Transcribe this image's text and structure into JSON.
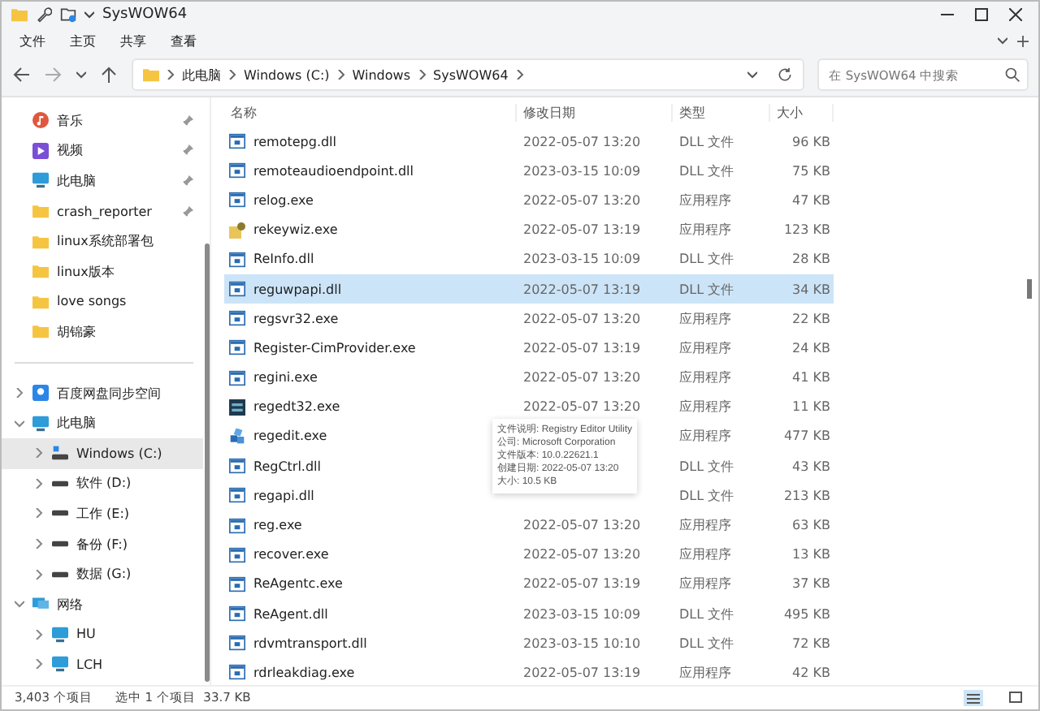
{
  "window": {
    "title": "SysWOW64"
  },
  "menu": [
    "文件",
    "主页",
    "共享",
    "查看"
  ],
  "breadcrumb": [
    "此电脑",
    "Windows (C:)",
    "Windows",
    "SysWOW64"
  ],
  "search": {
    "placeholder": "在 SysWOW64 中搜索"
  },
  "quick_access": [
    {
      "label": "音乐",
      "kind": "music",
      "pinned": true
    },
    {
      "label": "视频",
      "kind": "video",
      "pinned": true
    },
    {
      "label": "此电脑",
      "kind": "pc",
      "pinned": true
    },
    {
      "label": "crash_reporter",
      "kind": "folder",
      "pinned": true
    },
    {
      "label": "linux系统部署包",
      "kind": "folder",
      "pinned": false
    },
    {
      "label": "linux版本",
      "kind": "folder",
      "pinned": false
    },
    {
      "label": "love songs",
      "kind": "folder",
      "pinned": false
    },
    {
      "label": "胡锦豪",
      "kind": "folder",
      "pinned": false
    }
  ],
  "tree": [
    {
      "label": "百度网盘同步空间",
      "kind": "cloud",
      "expanded": false,
      "selected": false
    },
    {
      "label": "此电脑",
      "kind": "pc",
      "expanded": true,
      "selected": false,
      "children": [
        {
          "label": "Windows (C:)",
          "kind": "sysdrive",
          "expanded": false,
          "selected": true
        },
        {
          "label": "软件 (D:)",
          "kind": "drive",
          "expanded": false,
          "selected": false
        },
        {
          "label": "工作 (E:)",
          "kind": "drive",
          "expanded": false,
          "selected": false
        },
        {
          "label": "备份 (F:)",
          "kind": "drive",
          "expanded": false,
          "selected": false
        },
        {
          "label": "数据 (G:)",
          "kind": "drive",
          "expanded": false,
          "selected": false
        }
      ]
    },
    {
      "label": "网络",
      "kind": "network",
      "expanded": true,
      "selected": false,
      "children": [
        {
          "label": "HU",
          "kind": "pc",
          "expanded": false,
          "selected": false
        },
        {
          "label": "LCH",
          "kind": "pc",
          "expanded": false,
          "selected": false
        }
      ]
    }
  ],
  "table": {
    "columns": [
      "名称",
      "修改日期",
      "类型",
      "大小"
    ],
    "rows": [
      {
        "name": "remotepg.dll",
        "kind": "app",
        "date": "2022-05-07 13:20",
        "type": "DLL 文件",
        "size": "96 KB",
        "selected": false
      },
      {
        "name": "remoteaudioendpoint.dll",
        "kind": "app",
        "date": "2023-03-15 10:09",
        "type": "DLL 文件",
        "size": "75 KB",
        "selected": false
      },
      {
        "name": "relog.exe",
        "kind": "app",
        "date": "2022-05-07 13:20",
        "type": "应用程序",
        "size": "47 KB",
        "selected": false
      },
      {
        "name": "rekeywiz.exe",
        "kind": "key",
        "date": "2022-05-07 13:19",
        "type": "应用程序",
        "size": "123 KB",
        "selected": false
      },
      {
        "name": "ReInfo.dll",
        "kind": "app",
        "date": "2023-03-15 10:09",
        "type": "DLL 文件",
        "size": "28 KB",
        "selected": false
      },
      {
        "name": "reguwpapi.dll",
        "kind": "app",
        "date": "2022-05-07 13:19",
        "type": "DLL 文件",
        "size": "34 KB",
        "selected": true
      },
      {
        "name": "regsvr32.exe",
        "kind": "app",
        "date": "2022-05-07 13:20",
        "type": "应用程序",
        "size": "22 KB",
        "selected": false
      },
      {
        "name": "Register-CimProvider.exe",
        "kind": "app",
        "date": "2022-05-07 13:19",
        "type": "应用程序",
        "size": "24 KB",
        "selected": false
      },
      {
        "name": "regini.exe",
        "kind": "app",
        "date": "2022-05-07 13:20",
        "type": "应用程序",
        "size": "41 KB",
        "selected": false
      },
      {
        "name": "regedt32.exe",
        "kind": "dark",
        "date": "2022-05-07 13:20",
        "type": "应用程序",
        "size": "11 KB",
        "selected": false
      },
      {
        "name": "regedit.exe",
        "kind": "cubes",
        "type": "应用程序",
        "size": "477 KB",
        "selected": false
      },
      {
        "name": "RegCtrl.dll",
        "kind": "app",
        "type": "DLL 文件",
        "size": "43 KB",
        "selected": false
      },
      {
        "name": "regapi.dll",
        "kind": "app",
        "type": "DLL 文件",
        "size": "213 KB",
        "selected": false
      },
      {
        "name": "reg.exe",
        "kind": "app",
        "date": "2022-05-07 13:20",
        "type": "应用程序",
        "size": "63 KB",
        "selected": false
      },
      {
        "name": "recover.exe",
        "kind": "app",
        "date": "2022-05-07 13:20",
        "type": "应用程序",
        "size": "13 KB",
        "selected": false
      },
      {
        "name": "ReAgentc.exe",
        "kind": "app",
        "date": "2022-05-07 13:19",
        "type": "应用程序",
        "size": "37 KB",
        "selected": false
      },
      {
        "name": "ReAgent.dll",
        "kind": "app",
        "date": "2023-03-15 10:09",
        "type": "DLL 文件",
        "size": "495 KB",
        "selected": false
      },
      {
        "name": "rdvmtransport.dll",
        "kind": "app",
        "date": "2023-03-15 10:10",
        "type": "DLL 文件",
        "size": "72 KB",
        "selected": false
      },
      {
        "name": "rdrleakdiag.exe",
        "kind": "app",
        "date": "2022-05-07 13:19",
        "type": "应用程序",
        "size": "42 KB",
        "selected": false
      }
    ]
  },
  "tooltip": [
    "文件说明: Registry Editor Utility",
    "公司: Microsoft Corporation",
    "文件版本: 10.0.22621.1",
    "创建日期: 2022-05-07 13:20",
    "大小: 10.5 KB"
  ],
  "status_bar": {
    "count": "3,403 个项目",
    "selection": "选中 1 个项目  33.7 KB"
  },
  "views": [
    {
      "kind": "details",
      "selected": true
    },
    {
      "kind": "tiles",
      "selected": false
    }
  ]
}
